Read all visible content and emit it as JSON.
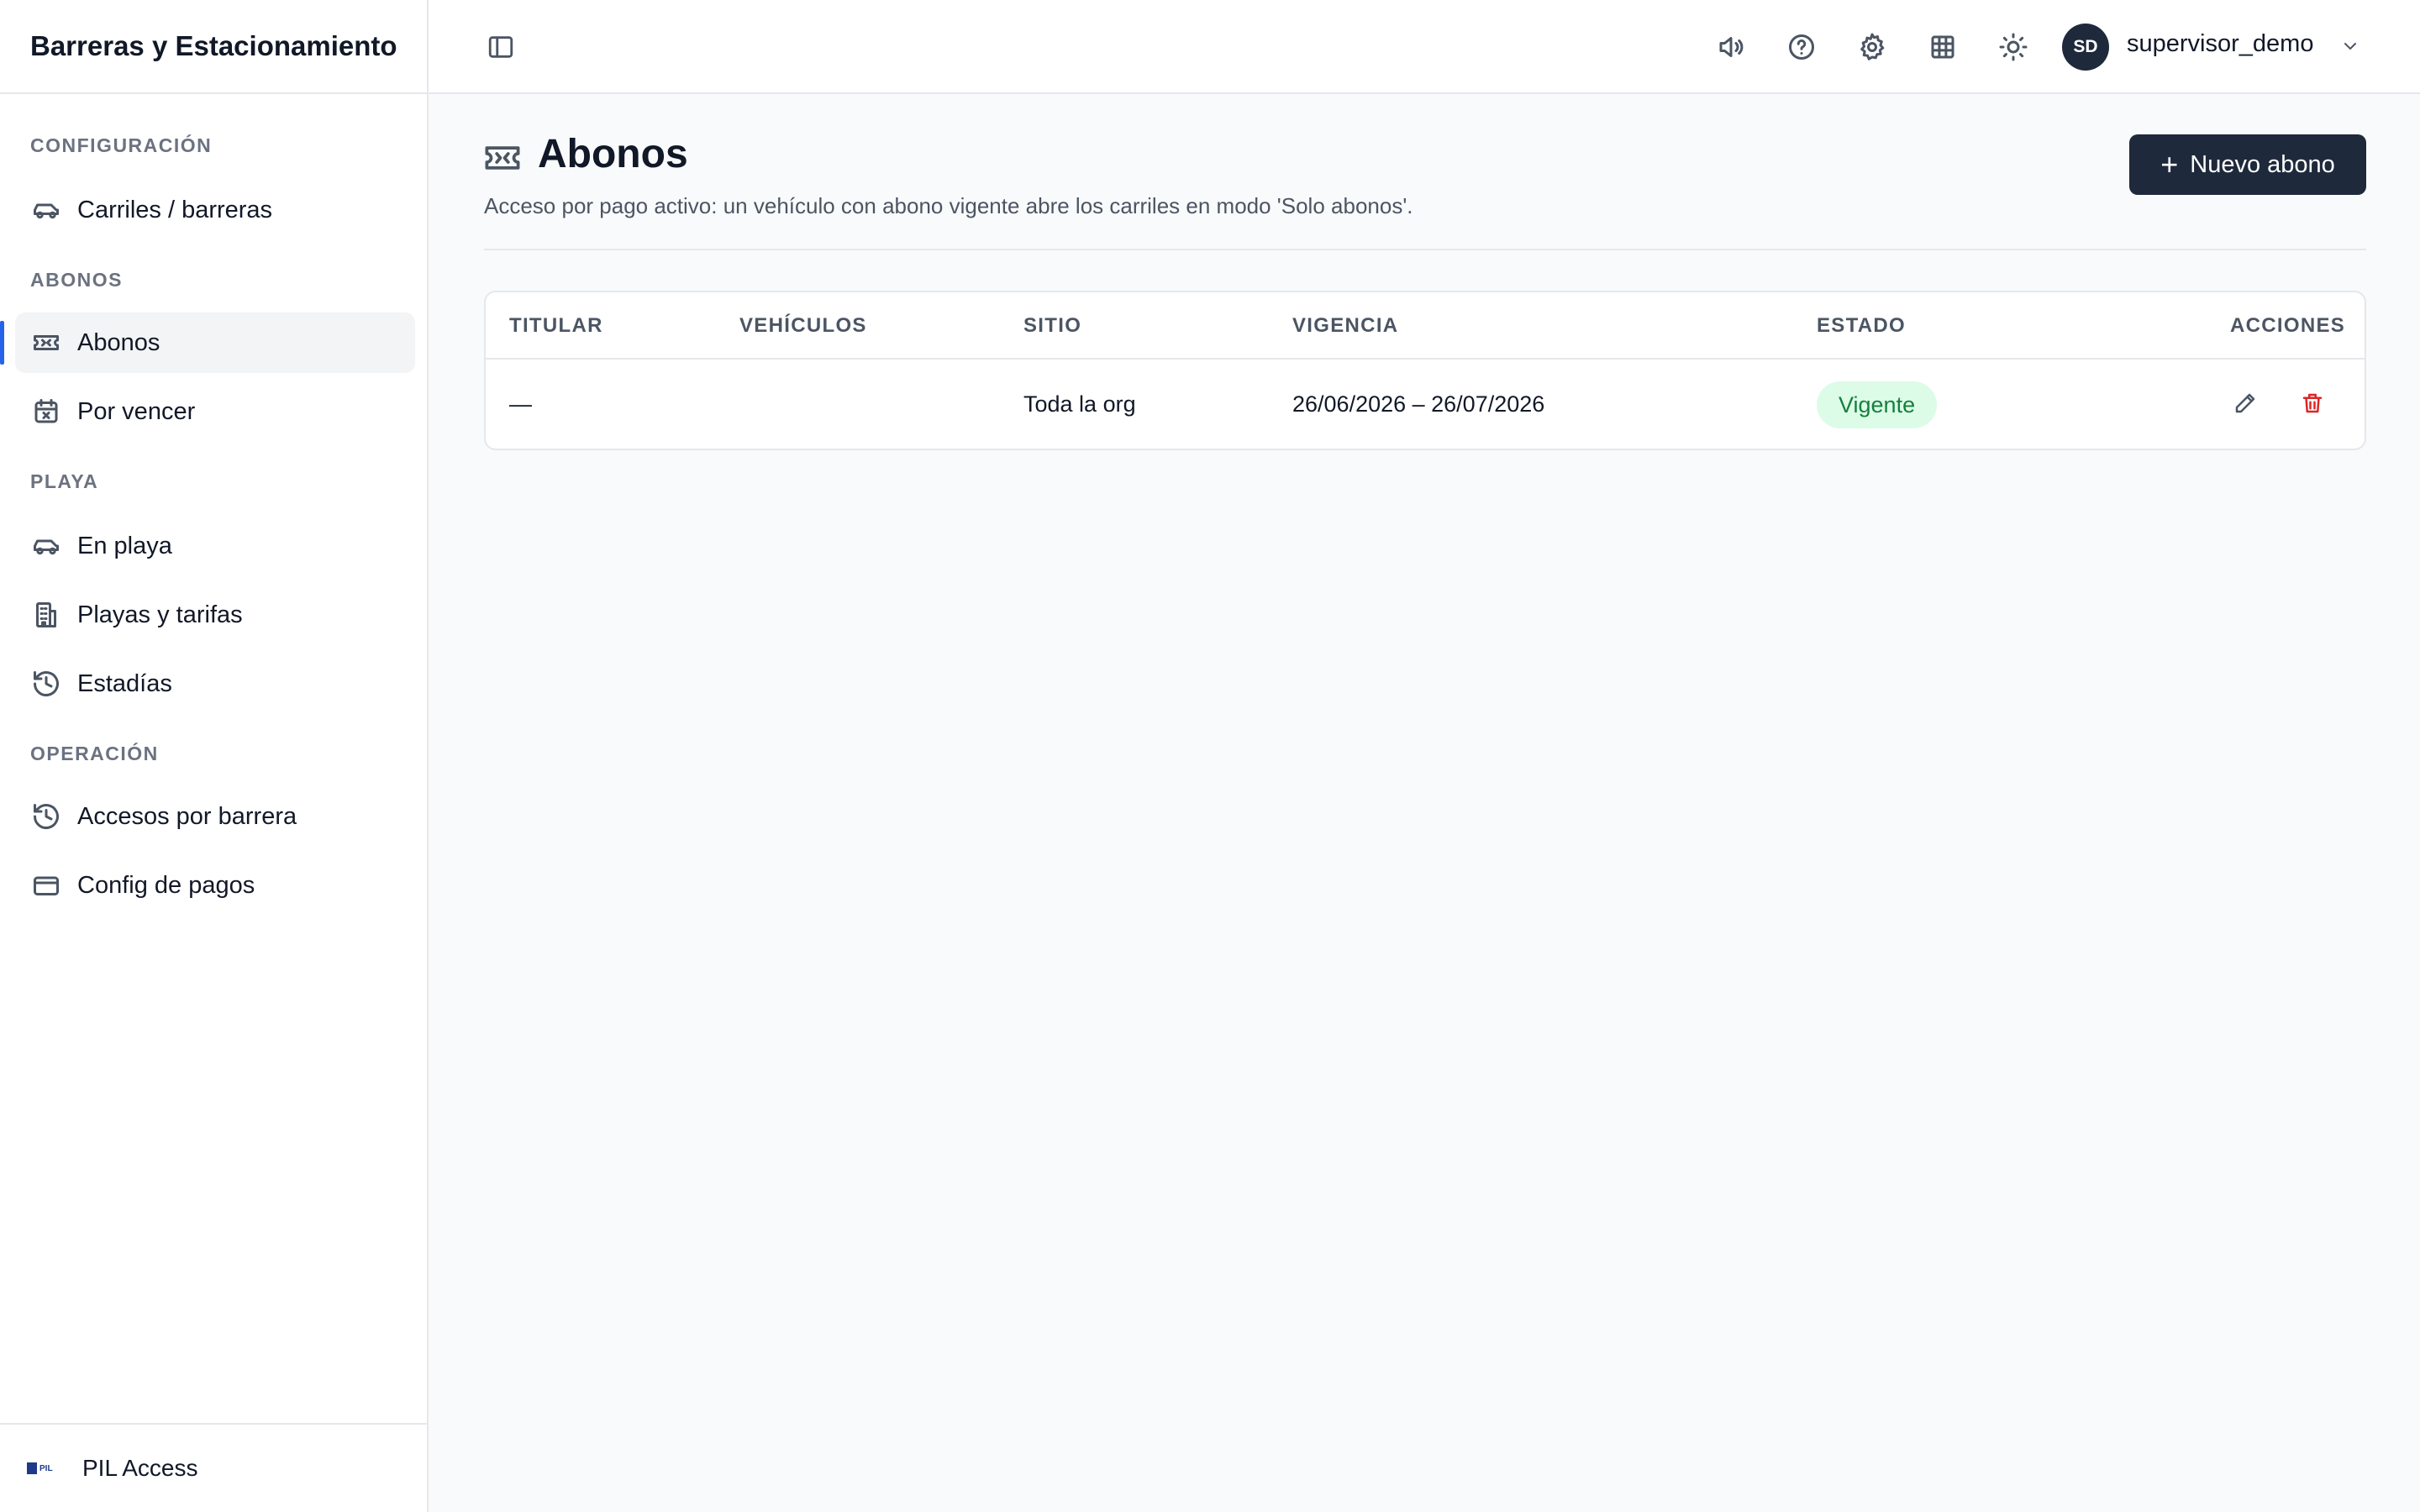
{
  "app": {
    "title": "Barreras y Estacionamiento"
  },
  "sidebar": {
    "sections": [
      {
        "title": "Configuración",
        "items": [
          {
            "label": "Carriles / barreras",
            "icon": "car-icon"
          }
        ]
      },
      {
        "title": "Abonos",
        "items": [
          {
            "label": "Abonos",
            "icon": "ticket-icon",
            "active": true
          },
          {
            "label": "Por vencer",
            "icon": "calendar-x-icon"
          }
        ]
      },
      {
        "title": "Playa",
        "items": [
          {
            "label": "En playa",
            "icon": "car-icon"
          },
          {
            "label": "Playas y tarifas",
            "icon": "building-icon"
          },
          {
            "label": "Estadías",
            "icon": "history-icon"
          }
        ]
      },
      {
        "title": "Operación",
        "items": [
          {
            "label": "Accesos por barrera",
            "icon": "history-icon"
          },
          {
            "label": "Config de pagos",
            "icon": "credit-card-icon"
          }
        ]
      }
    ],
    "footer": {
      "label": "PIL Access",
      "logo_text": "PIL"
    }
  },
  "header": {
    "icons": [
      "sidebar-toggle-icon",
      "volume-icon",
      "help-icon",
      "settings-icon",
      "grid-icon",
      "sun-icon",
      "chevron-down-icon"
    ],
    "user": {
      "initials": "SD",
      "name": "supervisor_demo"
    }
  },
  "page": {
    "title": "Abonos",
    "subtitle": "Acceso por pago activo: un vehículo con abono vigente abre los carriles en modo 'Solo abonos'.",
    "new_button": "Nuevo abono"
  },
  "table": {
    "columns": [
      "Titular",
      "Vehículos",
      "Sitio",
      "Vigencia",
      "Estado",
      "Acciones"
    ],
    "rows": [
      {
        "titular": "—",
        "vehiculos": "",
        "sitio": "Toda la org",
        "vigencia": "26/06/2026 – 26/07/2026",
        "estado": "Vigente"
      }
    ]
  },
  "colors": {
    "accent": "#1e293b",
    "active_indicator": "#2563eb",
    "status_ok_bg": "#dcfce7",
    "status_ok_text": "#15803d",
    "danger": "#dc2626"
  }
}
